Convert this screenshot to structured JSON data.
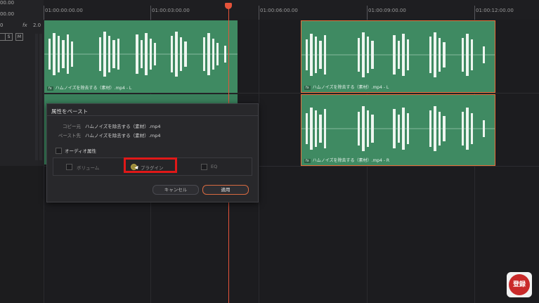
{
  "header": {
    "timecode_top": "00.00",
    "timecode_left": "00.00"
  },
  "ruler": {
    "ticks": [
      "01:00:00:00.00",
      "01:00:03:00.00",
      "01:00:06:00.00",
      "01:00:09:00.00",
      "01:00:12:00.00"
    ]
  },
  "track_header": {
    "track_id": "0",
    "fx_label": "fx",
    "level": "2.0",
    "solo": "S",
    "mute": "M"
  },
  "clips": {
    "a_left": "ハムノイズを除去する（素材）.mp4 - L",
    "b_left": "ハムノイズを除去する（素材）.mp4 - L",
    "b_right": "ハムノイズを除去する（素材）.mp4 - R",
    "fx_badge": "fx"
  },
  "dialog": {
    "title": "属性をペースト",
    "copy_from_label": "コピー元",
    "copy_from_value": "ハムノイズを除去する（素材）.mp4",
    "paste_to_label": "ペースト先",
    "paste_to_value": "ハムノイズを除去する（素材）.mp4",
    "audio_attributes": "オーディオ属性",
    "volume": "ボリューム",
    "plugins": "プラグイン",
    "eq": "EQ",
    "cancel": "キャンセル",
    "apply": "適用"
  },
  "badge": {
    "text": "登録"
  },
  "colors": {
    "clip_green": "#3f8a62",
    "selection_orange": "#e8703a",
    "playhead_red": "#e5533a",
    "highlight_red": "#e01818"
  }
}
